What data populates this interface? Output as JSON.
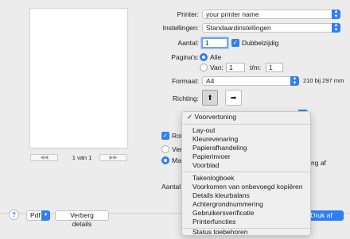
{
  "preview": {
    "page_indicator": "1 van 1",
    "first_label": "◀◀",
    "prev_label": "◀",
    "next_label": "▶",
    "last_label": "▶▶"
  },
  "settings": {
    "printer_label": "Printer:",
    "printer_value": "your printer name",
    "presets_label": "Instellingen:",
    "presets_value": "Standaardinstellingen",
    "copies_label": "Aantal:",
    "copies_value": "1",
    "duplex_label": "Dubbelzijdig",
    "pages_label": "Pagina's:",
    "pages_all_label": "Alle",
    "pages_from_label": "Van:",
    "pages_from_value": "1",
    "pages_to_label": "t/m:",
    "pages_to_value": "1",
    "format_label": "Formaat:",
    "format_value": "A4",
    "format_size": "210 bij 297 mm",
    "orientation_label": "Richting:"
  },
  "obscured": {
    "rotate_label": "Rote",
    "radio1_label": "Verg",
    "radio2_label": "Maa",
    "radio2_suffix": "ng af",
    "copies_partial": "Aantal p"
  },
  "menu": {
    "items_group1": [
      "Voorvertoning"
    ],
    "items_group2": [
      "Lay-out",
      "Kleurevenaring",
      "Papierafhandeling",
      "Papierinvoer",
      "Voorblad"
    ],
    "items_group3": [
      "Takenlogboek",
      "Voorkomen van onbevoegd kopiëren",
      "Details kleurbalans",
      "Achtergrondnummering",
      "Gebruikersverificatie",
      "Printerfuncties"
    ],
    "items_group4": [
      "Status toebehoren"
    ],
    "checkmark": "✓"
  },
  "footer": {
    "help": "?",
    "pdf": "Pdf",
    "hide_details": "Verberg details",
    "print": "Druk af"
  },
  "colors": {
    "accent": "#2f7ef6"
  }
}
